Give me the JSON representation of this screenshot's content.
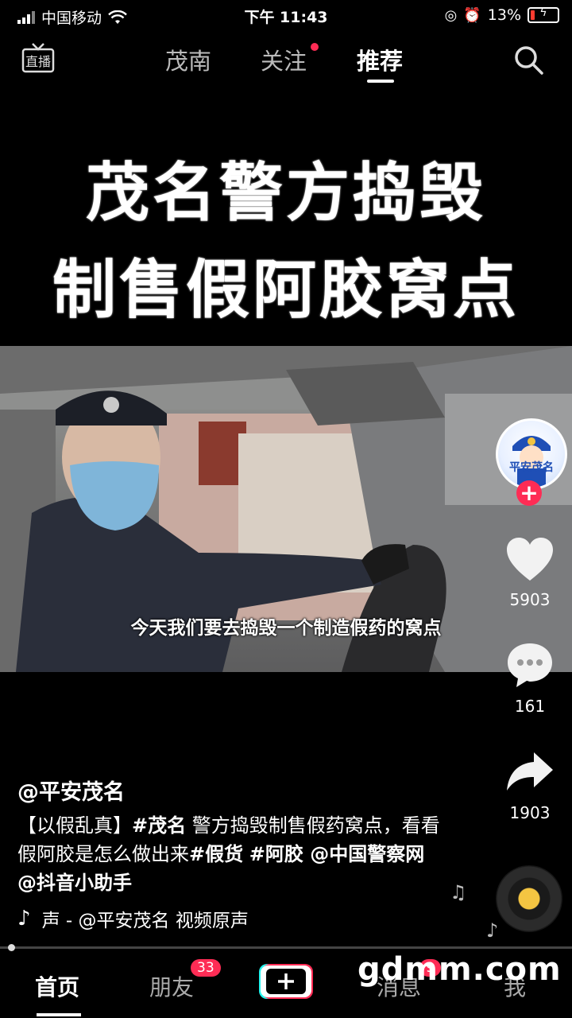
{
  "status_bar": {
    "carrier": "中国移动",
    "time": "下午 11:43",
    "battery": "13%"
  },
  "top_nav": {
    "live_label": "直播",
    "tabs": [
      "茂南",
      "关注",
      "推荐"
    ],
    "active_tab": "推荐"
  },
  "headline": {
    "line1": "茂名警方捣毁",
    "line2": "制售假阿胶窝点"
  },
  "video": {
    "subtitle": "今天我们要去捣毁一个制造假药的窝点"
  },
  "right_rail": {
    "avatar_text": "平安茂名",
    "likes": "5903",
    "comments": "161",
    "shares": "1903"
  },
  "post": {
    "author": "@平安茂名",
    "caption_parts": [
      "【以假乱真】",
      "#茂名",
      " 警方捣毁制售假药窝点，看看假阿胶是怎么做出来",
      "#假货",
      " ",
      "#阿胶",
      " @中国警察网 @抖音小助手"
    ],
    "music": "声 - @平安茂名    视频原声"
  },
  "bottom_nav": {
    "items": [
      "首页",
      "朋友",
      "消息",
      "我"
    ],
    "friends_badge": "33",
    "messages_badge": "9",
    "watermark": "gdmm.com"
  },
  "colors": {
    "accent": "#fe2c55",
    "background": "#000000"
  }
}
